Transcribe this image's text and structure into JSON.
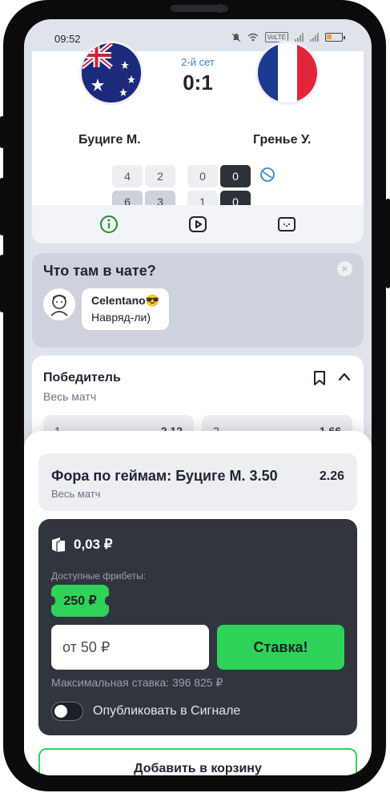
{
  "status_bar": {
    "time": "09:52",
    "volte": "VoLTE"
  },
  "match": {
    "set_label": "2-й сет",
    "score": "0:1",
    "player1": "Буциге М.",
    "player2": "Гренье У.",
    "player1_row": [
      "4",
      "2",
      "0",
      "0"
    ],
    "player2_row": [
      "6",
      "3",
      "1",
      "0"
    ],
    "colors": {
      "set_label": "#3b82c4",
      "info_icon": "#1f8f2e"
    },
    "icons": [
      "info-icon",
      "video-icon",
      "field-icon",
      "serve-ball-icon"
    ]
  },
  "chat": {
    "title": "Что там в чате?",
    "author": "Celentano😎",
    "message": "Навряд-ли)",
    "close_label": "×"
  },
  "winner": {
    "title": "Победитель",
    "subtitle": "Весь матч",
    "odd1_label": "1",
    "odd1_value": "2.12",
    "odd2_label": "2",
    "odd2_value": "1.66"
  },
  "bet_slip": {
    "title": "Фора по геймам: Буциге М. 3.50",
    "odd": "2.26",
    "subtitle": "Весь матч",
    "balance": "0,03 ₽",
    "freebets_label": "Доступные фрибеты:",
    "freebet_amount": "250 ₽",
    "stake_placeholder": "от 50 ₽",
    "bet_button": "Ставка!",
    "max_stake": "Максимальная ставка: 396 825 ₽",
    "publish_label": "Опубликовать в Сигнале",
    "publish_enabled": false,
    "add_to_basket": "Добавить в корзину",
    "accent_color": "#2fd35a"
  }
}
